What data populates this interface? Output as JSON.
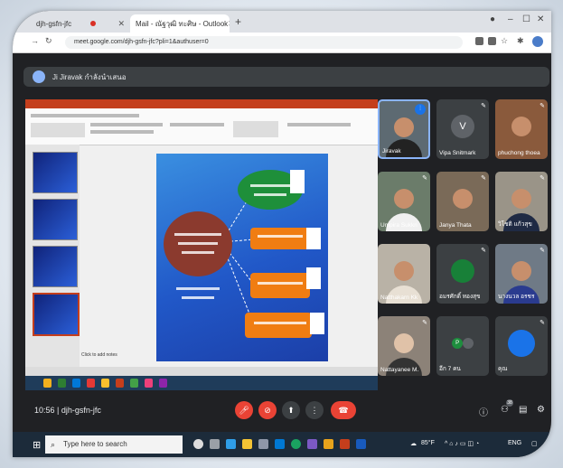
{
  "browser": {
    "tab1_title": "djh-gsfn-jfc",
    "tab2_title": "Mail - ณัฐวุฒิ ทะศิษ - Outlook",
    "url": "meet.google.com/djh-gsfn-jfc?pli=1&authuser=0"
  },
  "meet": {
    "presenting_text": "Ji Jiravak กำลังนำเสนอ",
    "time": "10:56",
    "meeting_code": "djh-gsfn-jfc",
    "participants_badge": "38"
  },
  "slide": {
    "notes_placeholder": "Click to add notes"
  },
  "participants": [
    {
      "name": "Jiravak",
      "kind": "video",
      "speaking": true
    },
    {
      "name": "Vipa Snitmark",
      "kind": "avatar",
      "initial": "V",
      "color": "#5f6368"
    },
    {
      "name": "phuchong thoea",
      "kind": "video"
    },
    {
      "name": "Umpira Sukkri",
      "kind": "video"
    },
    {
      "name": "Janya Thata",
      "kind": "video"
    },
    {
      "name": "วิโชติ แก้วสุข",
      "kind": "video"
    },
    {
      "name": "Natthakarn Kk",
      "kind": "video"
    },
    {
      "name": "อมรศักดิ์ ทองสุข",
      "kind": "avatar",
      "initial": "",
      "color": "#188038"
    },
    {
      "name": "นางนวล อรชร",
      "kind": "video"
    },
    {
      "name": "Nattayanee M.",
      "kind": "video"
    },
    {
      "name": "อีก 7 คน",
      "kind": "more"
    },
    {
      "name": "คุณ",
      "kind": "self"
    }
  ],
  "taskbar": {
    "search_placeholder": "Type here to search",
    "weather": "85°F",
    "language": "ENG"
  },
  "colors": {
    "meet_bg": "#202124",
    "tile_bg": "#3c4043",
    "end_call": "#ea4335",
    "ppt_accent": "#c43e1c",
    "slide_blue": "#2158c8"
  }
}
